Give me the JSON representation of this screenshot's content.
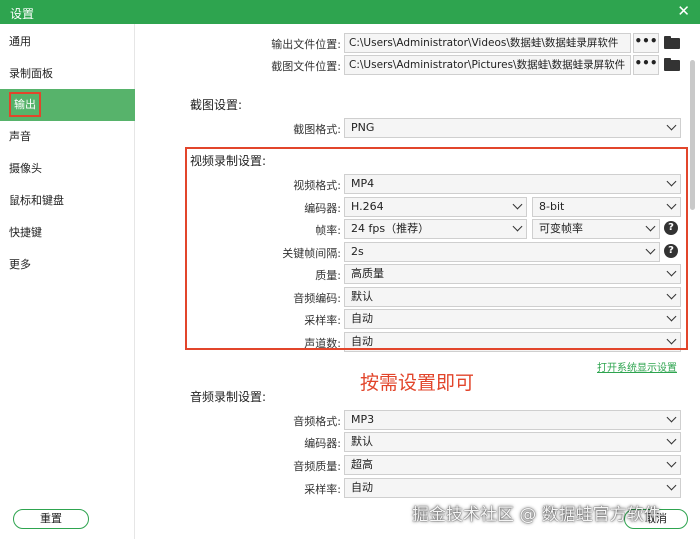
{
  "window": {
    "title": "设置",
    "close_glyph": "✕"
  },
  "sidebar": {
    "items": [
      {
        "label": "通用"
      },
      {
        "label": "录制面板"
      },
      {
        "label": "输出"
      },
      {
        "label": "声音"
      },
      {
        "label": "摄像头"
      },
      {
        "label": "鼠标和键盘"
      },
      {
        "label": "快捷键"
      },
      {
        "label": "更多"
      }
    ],
    "active_index": 2
  },
  "output_paths": {
    "output_label": "输出文件位置:",
    "output_value": "C:\\Users\\Administrator\\Videos\\数据蛙\\数据蛙录屏软件",
    "screenshot_label": "截图文件位置:",
    "screenshot_value": "C:\\Users\\Administrator\\Pictures\\数据蛙\\数据蛙录屏软件",
    "browse_glyph": "•••"
  },
  "screenshot_settings": {
    "title": "截图设置:",
    "format_label": "截图格式:",
    "format_value": "PNG"
  },
  "video_settings": {
    "title": "视频录制设置:",
    "format_label": "视频格式:",
    "format_value": "MP4",
    "encoder_label": "编码器:",
    "encoder_value": "H.264",
    "bitdepth_value": "8-bit",
    "framerate_label": "帧率:",
    "framerate_value": "24 fps（推荐）",
    "framerate_mode_value": "可变帧率",
    "keyframe_label": "关键帧间隔:",
    "keyframe_value": "2s",
    "quality_label": "质量:",
    "quality_value": "高质量",
    "audio_codec_label": "音频编码:",
    "audio_codec_value": "默认",
    "samplerate_label": "采样率:",
    "samplerate_value": "自动",
    "channels_label": "声道数:",
    "channels_value": "自动",
    "help_glyph": "?"
  },
  "display_settings_link": "打开系统显示设置",
  "annotation": "按需设置即可",
  "audio_settings": {
    "title": "音频录制设置:",
    "format_label": "音频格式:",
    "format_value": "MP3",
    "encoder_label": "编码器:",
    "encoder_value": "默认",
    "quality_label": "音频质量:",
    "quality_value": "超高",
    "samplerate_label": "采样率:",
    "samplerate_value": "自动"
  },
  "footer": {
    "reset_label": "重置",
    "cancel_label": "取消"
  },
  "watermark": "掘金技术社区 @ 数据蛙官方软件",
  "colors": {
    "accent": "#2ea44f",
    "highlight_red": "#e2452b",
    "active_item_bg": "#57b36b"
  },
  "icons": [
    "close-icon",
    "folder-icon",
    "chevron-down-icon",
    "help-icon"
  ]
}
